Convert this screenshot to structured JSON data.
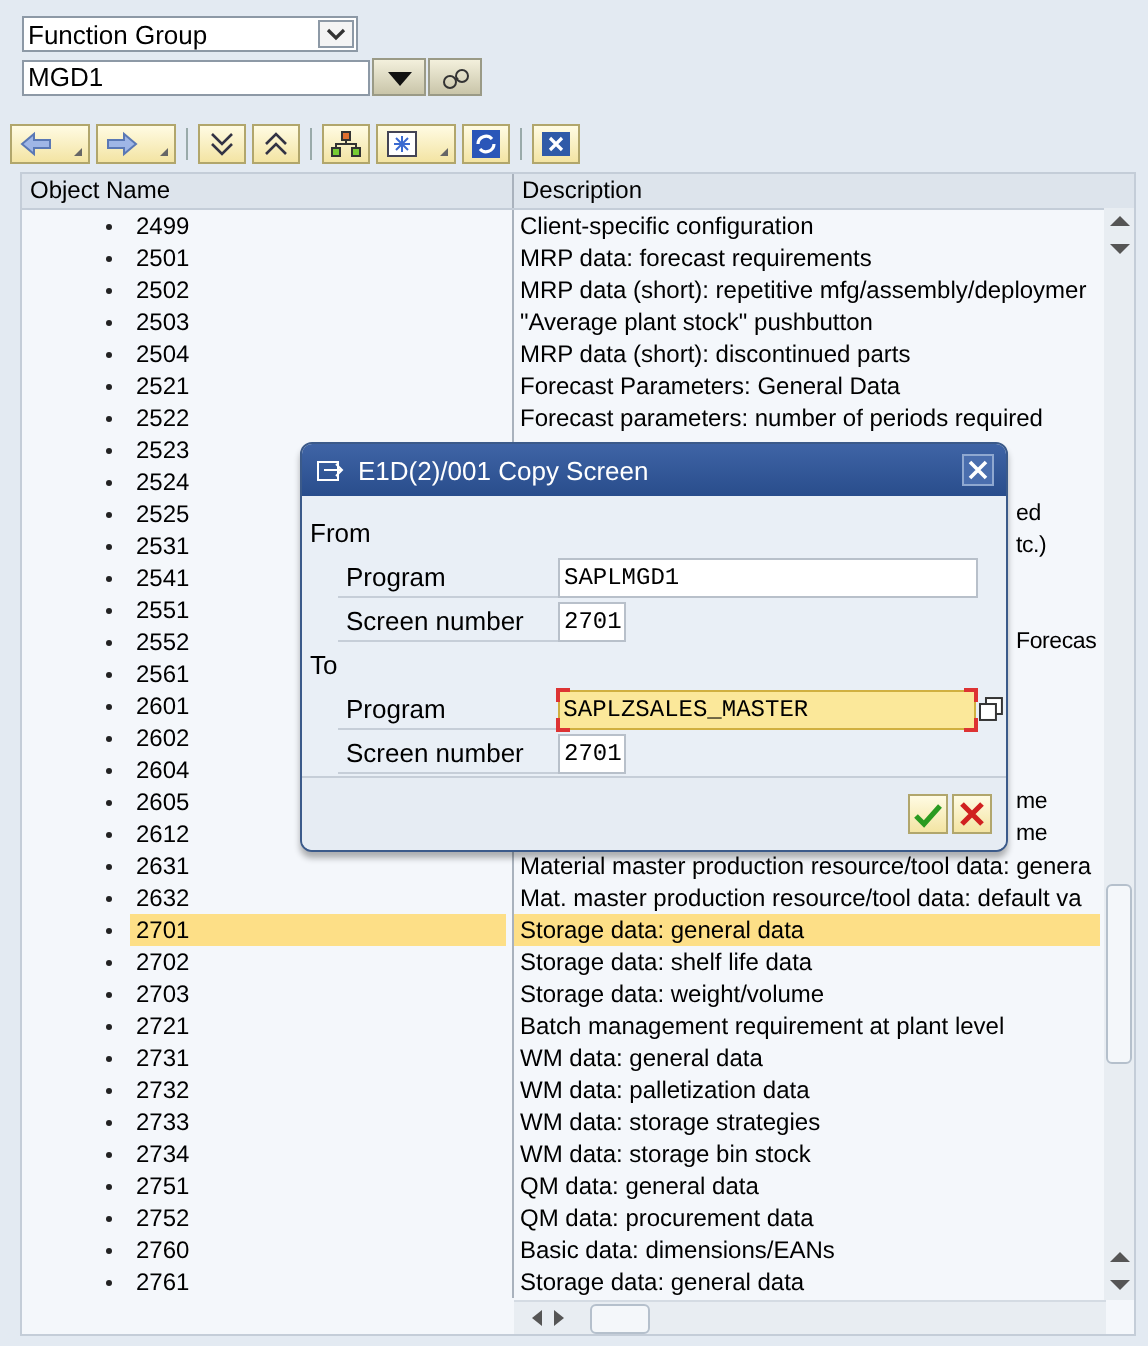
{
  "selector": {
    "value": "Function Group"
  },
  "object_field": {
    "value": "MGD1"
  },
  "table": {
    "columns": [
      "Object Name",
      "Description"
    ],
    "rows": [
      {
        "name": "2499",
        "description": "Client-specific configuration",
        "kind": "full",
        "selected": false
      },
      {
        "name": "2501",
        "description": "MRP data: forecast requirements",
        "kind": "full",
        "selected": false
      },
      {
        "name": "2502",
        "description": "MRP data (short): repetitive mfg/assembly/deploymer",
        "kind": "full",
        "selected": false
      },
      {
        "name": "2503",
        "description": "\"Average plant stock\" pushbutton",
        "kind": "full",
        "selected": false
      },
      {
        "name": "2504",
        "description": "MRP data (short): discontinued parts",
        "kind": "full",
        "selected": false
      },
      {
        "name": "2521",
        "description": "Forecast Parameters: General Data",
        "kind": "full",
        "selected": false
      },
      {
        "name": "2522",
        "description": "Forecast parameters: number of periods required",
        "kind": "full",
        "selected": false
      },
      {
        "name": "2523",
        "selected": false
      },
      {
        "name": "2524",
        "selected": false
      },
      {
        "name": "2525",
        "description": "ed",
        "kind": "partial",
        "selected": false
      },
      {
        "name": "2531",
        "description": "tc.)",
        "kind": "partial",
        "selected": false
      },
      {
        "name": "2541",
        "selected": false
      },
      {
        "name": "2551",
        "selected": false
      },
      {
        "name": "2552",
        "description": "Forecas",
        "kind": "partial",
        "selected": false
      },
      {
        "name": "2561",
        "selected": false
      },
      {
        "name": "2601",
        "selected": false
      },
      {
        "name": "2602",
        "selected": false
      },
      {
        "name": "2604",
        "selected": false
      },
      {
        "name": "2605",
        "description": "me",
        "kind": "partial",
        "selected": false
      },
      {
        "name": "2612",
        "description": "me",
        "kind": "partial",
        "selected": false
      },
      {
        "name": "2631",
        "description": "Material master production resource/tool data: genera",
        "kind": "full",
        "selected": false
      },
      {
        "name": "2632",
        "description": "Mat. master production resource/tool data: default va",
        "kind": "full",
        "selected": false
      },
      {
        "name": "2701",
        "description": "Storage data: general data",
        "kind": "full",
        "selected": true
      },
      {
        "name": "2702",
        "description": "Storage data: shelf life data",
        "kind": "full",
        "selected": false
      },
      {
        "name": "2703",
        "description": "Storage data: weight/volume",
        "kind": "full",
        "selected": false
      },
      {
        "name": "2721",
        "description": "Batch management requirement at plant level",
        "kind": "full",
        "selected": false
      },
      {
        "name": "2731",
        "description": "WM data: general data",
        "kind": "full",
        "selected": false
      },
      {
        "name": "2732",
        "description": "WM data: palletization data",
        "kind": "full",
        "selected": false
      },
      {
        "name": "2733",
        "description": "WM data: storage strategies",
        "kind": "full",
        "selected": false
      },
      {
        "name": "2734",
        "description": "WM data: storage bin stock",
        "kind": "full",
        "selected": false
      },
      {
        "name": "2751",
        "description": "QM data: general data",
        "kind": "full",
        "selected": false
      },
      {
        "name": "2752",
        "description": "QM data: procurement data",
        "kind": "full",
        "selected": false
      },
      {
        "name": "2760",
        "description": "Basic data: dimensions/EANs",
        "kind": "full",
        "selected": false
      },
      {
        "name": "2761",
        "description": "Storage data: general data",
        "kind": "full",
        "selected": false
      }
    ]
  },
  "dialog": {
    "title": "E1D(2)/001 Copy Screen",
    "sections": [
      {
        "label": "From",
        "fields": [
          {
            "label": "Program",
            "value": "SAPLMGD1",
            "kind": "long",
            "focused": false
          },
          {
            "label": "Screen number",
            "value": "2701",
            "kind": "short",
            "focused": false
          }
        ]
      },
      {
        "label": "To",
        "fields": [
          {
            "label": "Program",
            "value": "SAPLZSALES_MASTER",
            "kind": "long",
            "focused": true
          },
          {
            "label": "Screen number",
            "value": "2701",
            "kind": "short",
            "focused": false
          }
        ]
      }
    ]
  }
}
